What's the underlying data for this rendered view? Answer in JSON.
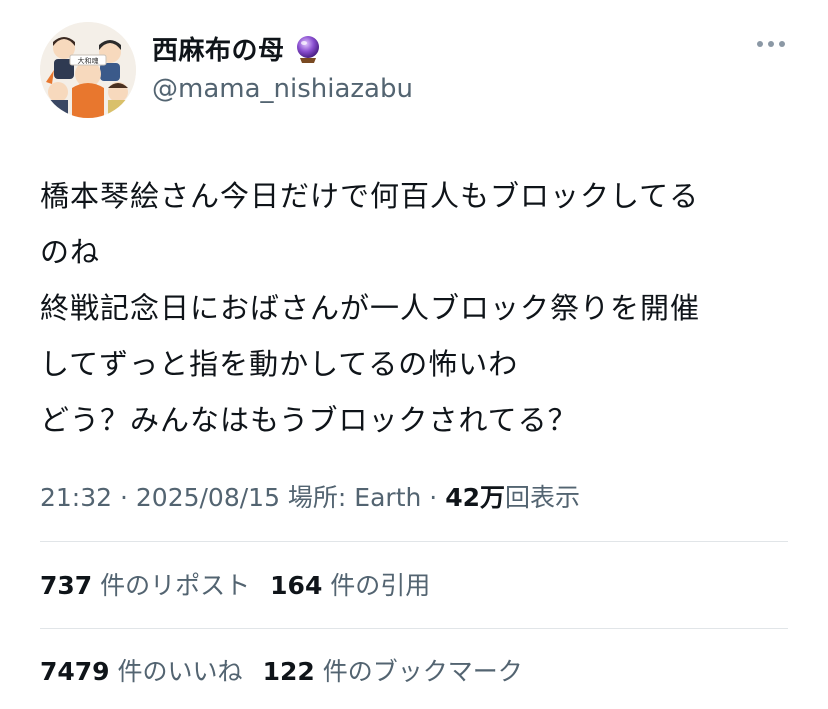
{
  "author": {
    "display_name": "西麻布の母",
    "badge_icon": "crystal-ball-icon",
    "handle": "@mama_nishiazabu",
    "avatar_icon": "group-of-people-illustration"
  },
  "more_icon": "more-options-icon",
  "tweet": {
    "lines": [
      "橋本琴絵さん今日だけで何百人もブロックしてる",
      "のね",
      "終戦記念日におばさんが一人ブロック祭りを開催",
      "してずっと指を動かしてるの怖いわ",
      "どう？みんなはもうブロックされてる？"
    ]
  },
  "meta": {
    "time": "21:32",
    "sep1": " · ",
    "date": "2025/08/15",
    "location": " 場所: Earth",
    "sep2": " · ",
    "views_count": "42万",
    "views_label": "回表示"
  },
  "stats": {
    "reposts_count": "737",
    "reposts_label": "件のリポスト",
    "quotes_count": "164",
    "quotes_label": "件の引用",
    "likes_count": "7479",
    "likes_label": "件のいいね",
    "bookmarks_count": "122",
    "bookmarks_label": "件のブックマーク"
  },
  "colors": {
    "text": "#0f1419",
    "secondary": "#536471",
    "divider": "#e1e5e8",
    "crystal": "#7b3fbf"
  }
}
